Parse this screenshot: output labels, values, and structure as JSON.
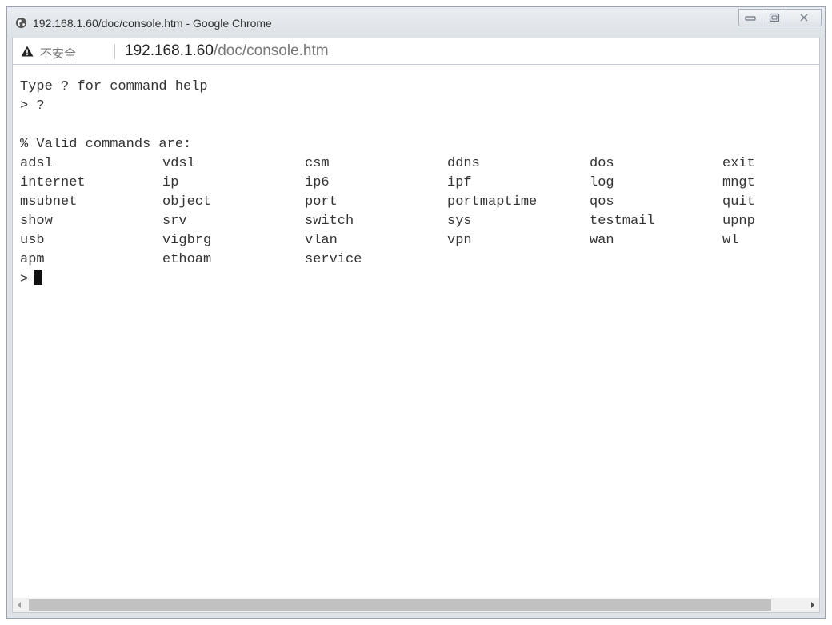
{
  "window": {
    "title": "192.168.1.60/doc/console.htm - Google Chrome",
    "icons": {
      "page": "globe-icon",
      "minimize": "minimize-icon",
      "maximize": "maximize-icon",
      "close": "close-icon"
    }
  },
  "address_bar": {
    "warning_icon": "warning-icon",
    "security_label": "不安全",
    "url_host": "192.168.1.60",
    "url_path": "/doc/console.htm"
  },
  "console": {
    "help_line": "Type ? for command help",
    "prompt_line": "> ?",
    "blank_line": "",
    "valid_header": "% Valid commands are:",
    "commands": [
      [
        "adsl",
        "vdsl",
        "csm",
        "ddns",
        "dos",
        "exit"
      ],
      [
        "internet",
        "ip",
        "ip6",
        "ipf",
        "log",
        "mngt"
      ],
      [
        "msubnet",
        "object",
        "port",
        "portmaptime",
        "qos",
        "quit"
      ],
      [
        "show",
        "srv",
        "switch",
        "sys",
        "testmail",
        "upnp"
      ],
      [
        "usb",
        "vigbrg",
        "vlan",
        "vpn",
        "wan",
        "wl"
      ],
      [
        "apm",
        "ethoam",
        "service"
      ]
    ],
    "current_prompt": ">"
  },
  "colors": {
    "console_text": "#333333",
    "chrome_frame": "#dfe3e8",
    "insecure_text": "#777777"
  }
}
